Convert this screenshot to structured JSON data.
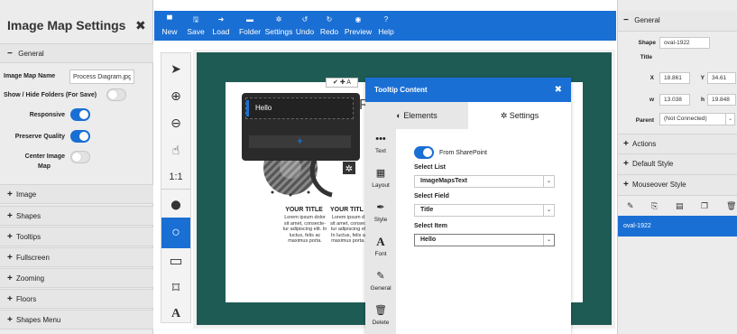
{
  "left_panel": {
    "title": "Image Map Settings",
    "close": "✖",
    "general": "General",
    "image_map_name_label": "Image Map Name",
    "image_map_name_value": "Process Diagram.jpg",
    "show_hide_folders_label": "Show / Hide Folders (For Save)",
    "show_hide_folders_on": false,
    "responsive_label": "Responsive",
    "responsive_on": true,
    "preserve_quality_label": "Preserve Quality",
    "preserve_quality_on": true,
    "center_image_label_1": "Center Image",
    "center_image_label_2": "Map",
    "center_image_on": false,
    "sections": [
      "Image",
      "Shapes",
      "Tooltips",
      "Fullscreen",
      "Zooming",
      "Floors",
      "Shapes Menu"
    ]
  },
  "toolbar": {
    "items": [
      {
        "label": "New",
        "icon": "▀"
      },
      {
        "label": "Save",
        "icon": "🖫"
      },
      {
        "label": "Load",
        "icon": "➜"
      },
      {
        "label": "Folder",
        "icon": "▬"
      },
      {
        "label": "Settings",
        "icon": "✲"
      },
      {
        "label": "Undo",
        "icon": "↺"
      },
      {
        "label": "Redo",
        "icon": "↻"
      },
      {
        "label": "Preview",
        "icon": "◉"
      },
      {
        "label": "Help",
        "icon": "?"
      }
    ]
  },
  "tools": {
    "pointer": "➤",
    "zoom_in": "⊕",
    "zoom_out": "⊖",
    "pan": "☝",
    "one_to_one": "1:1",
    "pin": "⬤",
    "oval": "○",
    "rect": "▭",
    "polygon": "⌑",
    "text": "A"
  },
  "canvas": {
    "popover_item": "Hello",
    "popover_add": "+",
    "mini_toolbar": "✔ ✚ A",
    "card1_title": "YOUR TITLE",
    "card1_text": "Lorem ipsum dolor sit amet, consecte- tur adipiscing elit. In luctus, felis ac maximus porta.",
    "card2_title": "YOUR TITL",
    "card2_text": "Lorem ipsum d sit amet, consec tur adipiscing el In luctus, felis a maximus porta.",
    "letter_r": "R"
  },
  "dialog": {
    "title": "Tooltip Content",
    "close": "✖",
    "tab_elements": "Elements",
    "tab_elements_icon": "◐",
    "tab_settings": "Settings",
    "tab_settings_icon": "✲",
    "side": [
      {
        "label": "Text",
        "icon": "•••"
      },
      {
        "label": "Layout",
        "icon": "▦"
      },
      {
        "label": "Style",
        "icon": "✒"
      },
      {
        "label": "Font",
        "icon": "A"
      },
      {
        "label": "General",
        "icon": "✎"
      },
      {
        "label": "Delete",
        "icon": "🗑"
      }
    ],
    "from_sharepoint_label": "From SharePoint",
    "from_sharepoint_on": true,
    "select_list_label": "Select List",
    "select_list_value": "ImageMapsText",
    "select_field_label": "Select Field",
    "select_field_value": "Title",
    "select_item_label": "Select Item",
    "select_item_value": "Hello",
    "caret": "⌄"
  },
  "right_panel": {
    "general": "General",
    "shape_label": "Shape",
    "shape_value": "oval-1922",
    "title_label": "Title",
    "x_label": "X",
    "x_value": "18.861",
    "y_label": "Y",
    "y_value": "34.61",
    "w_label": "w",
    "w_value": "13.038",
    "h_label": "h",
    "h_value": "19.848",
    "parent_label": "Parent",
    "parent_value": "(Not Connected)",
    "sections": [
      "Actions",
      "Default Style",
      "Mouseover Style"
    ],
    "list_item": "oval-1922"
  },
  "colors": {
    "accent": "#1a6fd4",
    "canvas_frame": "#1f5b55",
    "panel_bg": "#ececec"
  }
}
